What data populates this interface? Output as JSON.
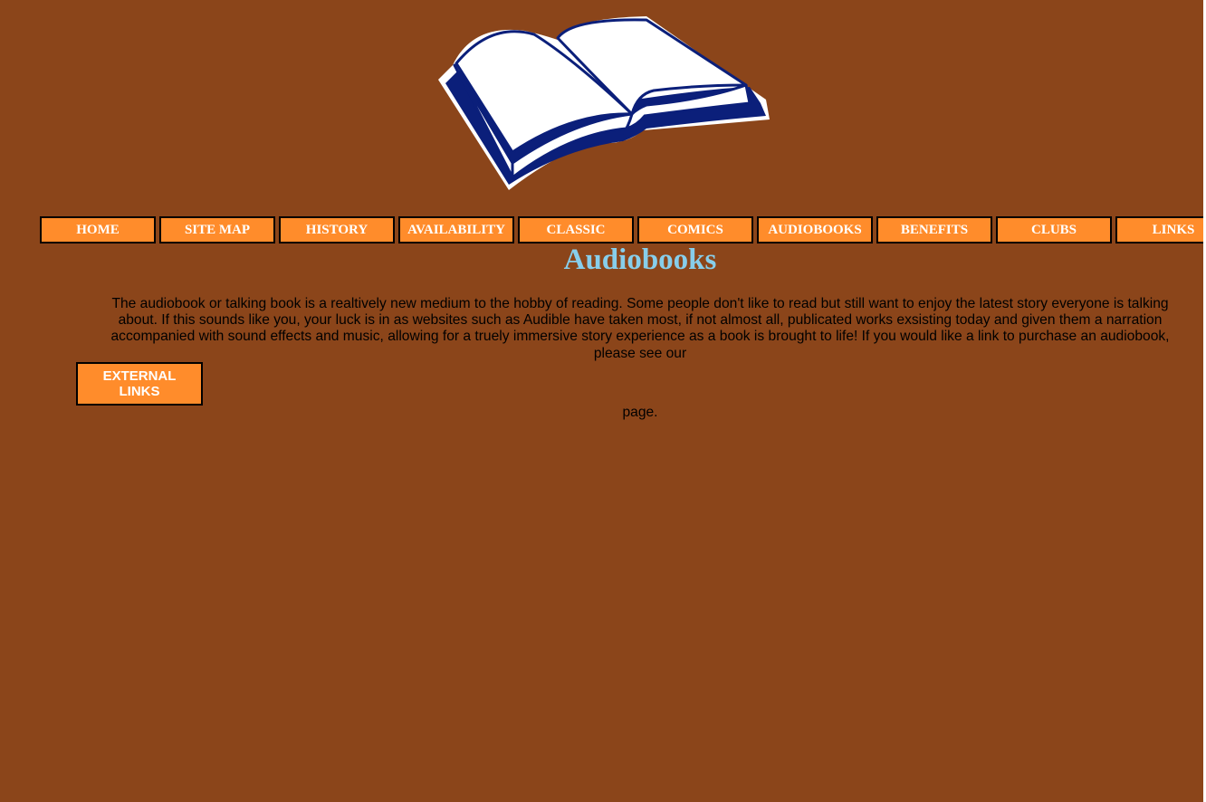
{
  "logo": {
    "icon": "open-book-icon"
  },
  "nav": {
    "items": [
      {
        "label": "HOME"
      },
      {
        "label": "SITE MAP"
      },
      {
        "label": "HISTORY"
      },
      {
        "label": "AVAILABILITY"
      },
      {
        "label": "CLASSIC"
      },
      {
        "label": "COMICS"
      },
      {
        "label": "AUDIOBOOKS"
      },
      {
        "label": "BENEFITS"
      },
      {
        "label": "CLUBS"
      },
      {
        "label": "LINKS"
      }
    ]
  },
  "main": {
    "title": "Audiobooks",
    "intro": "The audiobook or talking book is a realtively new medium to the hobby of reading. Some people don't like to read but still want to enjoy the latest story everyone is talking about. If this sounds like you, your luck is in as websites such as Audible have taken most, if not almost all, publicated works exsisting today and given them a narration accompanied with sound effects and music, allowing for a truely immersive story experience as a book is brought to life! If you would like a link to purchase an audiobook, please see our",
    "link_button": "EXTERNAL LINKS",
    "after_link": "page."
  },
  "colors": {
    "background": "#8B451A",
    "nav_button": "#FF8C2B",
    "title": "#87CEEB",
    "book_cover": "#0B1F7A"
  }
}
